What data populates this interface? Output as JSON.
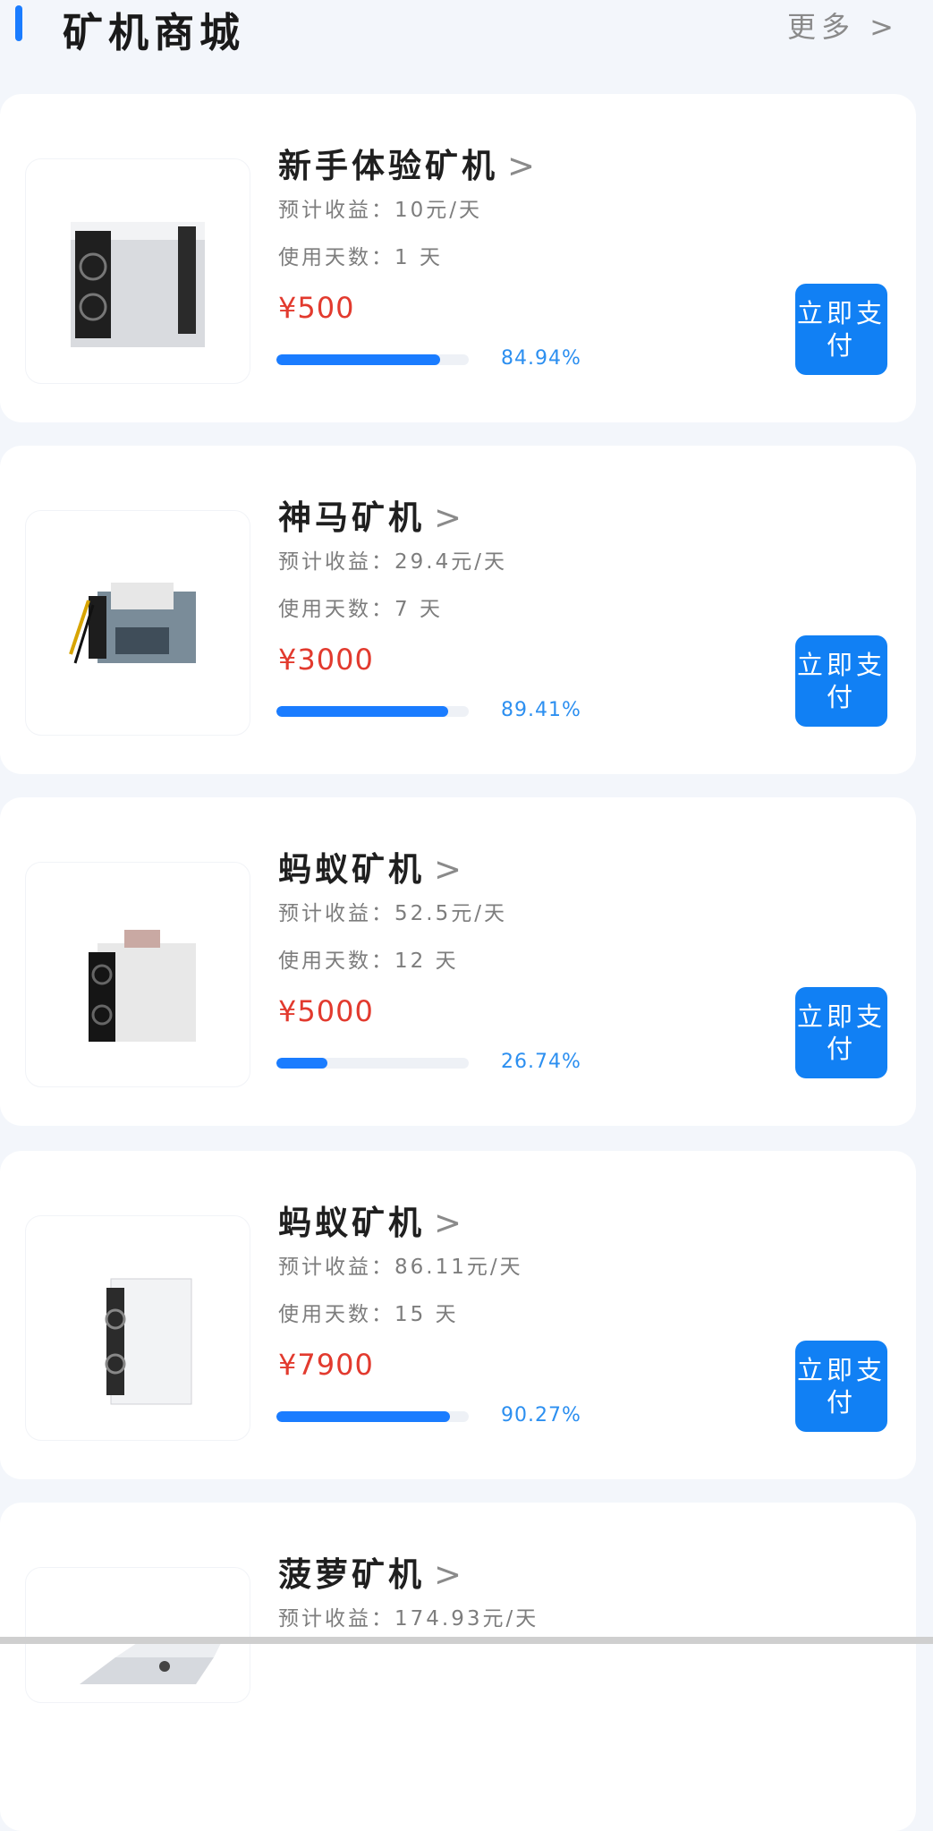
{
  "header": {
    "title": "矿机商城",
    "more_label": "更多 >"
  },
  "cards": [
    {
      "name": "新手体验矿机",
      "chevron": ">",
      "income": "预计收益：10元/天",
      "days": "使用天数：1 天",
      "price": "¥500",
      "progress": 0.8494,
      "percent_text": "84.94%",
      "pay_label": "立即支付",
      "image_icon": "miner-box-icon"
    },
    {
      "name": "神马矿机",
      "chevron": ">",
      "income": "预计收益：29.4元/天",
      "days": "使用天数：7 天",
      "price": "¥3000",
      "progress": 0.8941,
      "percent_text": "89.41%",
      "pay_label": "立即支付",
      "image_icon": "miner-board-icon"
    },
    {
      "name": "蚂蚁矿机",
      "chevron": ">",
      "income": "预计收益：52.5元/天",
      "days": "使用天数：12 天",
      "price": "¥5000",
      "progress": 0.2674,
      "percent_text": "26.74%",
      "pay_label": "立即支付",
      "image_icon": "miner-box-icon"
    },
    {
      "name": "蚂蚁矿机",
      "chevron": ">",
      "income": "预计收益：86.11元/天",
      "days": "使用天数：15 天",
      "price": "¥7900",
      "progress": 0.9027,
      "percent_text": "90.27%",
      "pay_label": "立即支付",
      "image_icon": "miner-box-icon"
    },
    {
      "name": "菠萝矿机",
      "chevron": ">",
      "income": "预计收益：174.93元/天",
      "days": "",
      "price": "",
      "progress": null,
      "percent_text": "",
      "pay_label": "",
      "image_icon": "miner-box-icon"
    }
  ],
  "colors": {
    "accent": "#1a7cff",
    "price": "#e23a2e",
    "button": "#1180f4"
  }
}
